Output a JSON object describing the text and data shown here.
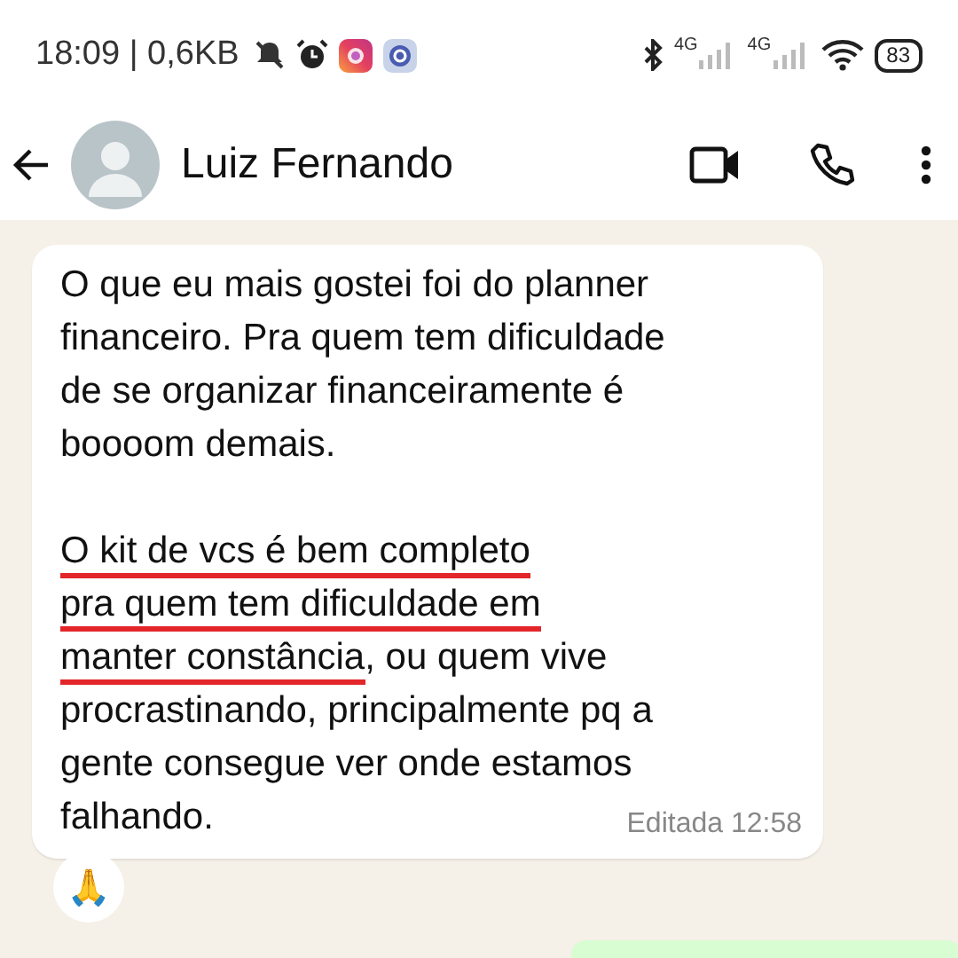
{
  "status_bar": {
    "time": "18:09 | 0,6KB",
    "sim_labels": [
      "4G",
      "4G"
    ],
    "battery": "83"
  },
  "header": {
    "contact_name": "Luiz Fernando"
  },
  "message": {
    "paragraphs": [
      [
        [
          {
            "text": "O que eu mais gostei foi do planner",
            "underlined": false
          }
        ],
        [
          {
            "text": "financeiro. Pra quem tem dificuldade",
            "underlined": false
          }
        ],
        [
          {
            "text": "de se organizar financeiramente é",
            "underlined": false
          }
        ],
        [
          {
            "text": "boooom demais.",
            "underlined": false
          }
        ]
      ],
      [
        [
          {
            "text": "O kit de vcs é bem completo",
            "underlined": true
          }
        ],
        [
          {
            "text": "pra quem tem dificuldade em",
            "underlined": true
          }
        ],
        [
          {
            "text": "manter constância",
            "underlined": true
          },
          {
            "text": ", ou quem vive",
            "underlined": false
          }
        ],
        [
          {
            "text": "procrastinando, principalmente pq a",
            "underlined": false
          }
        ],
        [
          {
            "text": "gente consegue ver onde estamos",
            "underlined": false
          }
        ],
        [
          {
            "text": "falhando.",
            "underlined": false
          }
        ]
      ]
    ],
    "edited_label": "Editada",
    "time": "12:58",
    "reaction": "🙏"
  }
}
